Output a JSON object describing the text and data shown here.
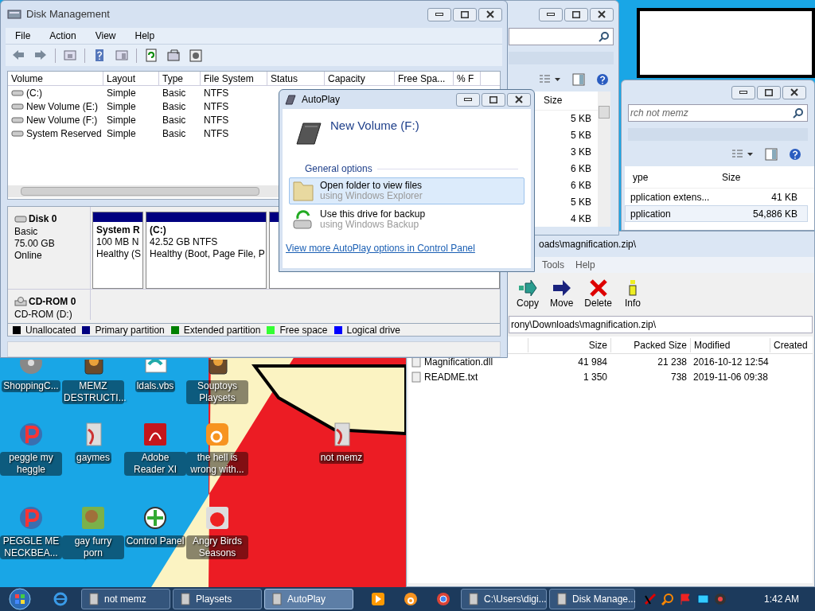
{
  "disk_management": {
    "title": "Disk Management",
    "menu": [
      "File",
      "Action",
      "View",
      "Help"
    ],
    "columns": [
      "Volume",
      "Layout",
      "Type",
      "File System",
      "Status",
      "Capacity",
      "Free Spa...",
      "% F"
    ],
    "rows": [
      {
        "cells": [
          "(C:)",
          "Simple",
          "Basic",
          "NTFS"
        ]
      },
      {
        "cells": [
          "New Volume (E:)",
          "Simple",
          "Basic",
          "NTFS"
        ]
      },
      {
        "cells": [
          "New Volume (F:)",
          "Simple",
          "Basic",
          "NTFS"
        ]
      },
      {
        "cells": [
          "System Reserved",
          "Simple",
          "Basic",
          "NTFS"
        ]
      }
    ],
    "disks": [
      {
        "kind": "disk",
        "name": "Disk 0",
        "lines": [
          "Basic",
          "75.00 GB",
          "Online"
        ],
        "partitions": [
          {
            "lines": [
              "System R",
              "100 MB N",
              "Healthy (S"
            ]
          },
          {
            "lines": [
              "(C:)",
              "42.52 GB NTFS",
              "Healthy (Boot, Page File, P"
            ]
          }
        ]
      },
      {
        "kind": "cdrom",
        "name": "CD-ROM 0",
        "lines": [
          "CD-ROM (D:)"
        ]
      }
    ],
    "legend": [
      {
        "label": "Unallocated",
        "color": "#000000"
      },
      {
        "label": "Primary partition",
        "color": "#000080"
      },
      {
        "label": "Extended partition",
        "color": "#008000"
      },
      {
        "label": "Free space",
        "color": "#33ff33"
      },
      {
        "label": "Logical drive",
        "color": "#0000ff"
      }
    ]
  },
  "explorer_back": {
    "column": "Size",
    "sizes": [
      "5 KB",
      "5 KB",
      "3 KB",
      "6 KB",
      "6 KB",
      "5 KB",
      "4 KB"
    ]
  },
  "explorer_front": {
    "search": {
      "placeholder": "rch not memz"
    },
    "columns": [
      "ype",
      "Size"
    ],
    "rows": [
      {
        "type": "pplication extens...",
        "size": "41 KB",
        "selected": false
      },
      {
        "type": "pplication",
        "size": "54,886 KB",
        "selected": true
      }
    ]
  },
  "autoplay": {
    "title": "AutoPlay",
    "drive": "New Volume (F:)",
    "section": "General options",
    "options": [
      {
        "kind": "folder",
        "title": "Open folder to view files",
        "subtitle": "using Windows Explorer",
        "selected": true
      },
      {
        "kind": "backup",
        "title": "Use this drive for backup",
        "subtitle": "using Windows Backup",
        "selected": false
      }
    ],
    "link": "View more AutoPlay options in Control Panel"
  },
  "sevenzip": {
    "title": "oads\\magnification.zip\\",
    "menu": [
      "Tools",
      "Help"
    ],
    "toolbar": [
      {
        "kind": "copy",
        "label": "Copy"
      },
      {
        "kind": "move",
        "label": "Move"
      },
      {
        "kind": "delete",
        "label": "Delete"
      },
      {
        "kind": "info",
        "label": "Info"
      }
    ],
    "path": "rony\\Downloads\\magnification.zip\\",
    "columns": [
      "Size",
      "Packed Size",
      "Modified",
      "Created"
    ],
    "rows": [
      {
        "name": "Magnification.dll",
        "size": "41 984",
        "packed": "21 238",
        "modified": "2016-10-12 12:54"
      },
      {
        "name": "README.txt",
        "size": "1 350",
        "packed": "738",
        "modified": "2019-11-06 09:38"
      }
    ]
  },
  "desktop_icons": [
    [
      {
        "kind": "disc",
        "label": "ShoppingC..."
      },
      {
        "kind": "program",
        "label": "MEMZ DESTRUCTI..."
      },
      {
        "kind": "script",
        "label": "ldals.vbs"
      },
      {
        "kind": "program",
        "label": "Souptoys Playsets"
      }
    ],
    [
      {
        "kind": "game",
        "label": "peggle my heggle"
      },
      {
        "kind": "folder",
        "label": "gaymes"
      },
      {
        "kind": "pdf",
        "label": "Adobe Reader XI"
      },
      {
        "kind": "browser",
        "label": "the hell is wrong with..."
      },
      {
        "kind": "folder",
        "label": "not memz"
      }
    ],
    [
      {
        "kind": "game",
        "label": "PEGGLE ME NECKBEA..."
      },
      {
        "kind": "box",
        "label": "gay furry porn"
      },
      {
        "kind": "control",
        "label": "Control Panel"
      },
      {
        "kind": "birds",
        "label": "Angry Birds Seasons"
      }
    ]
  ],
  "taskbar": {
    "windows": [
      {
        "label": "not memz",
        "selected": false
      },
      {
        "label": "Playsets",
        "selected": false
      },
      {
        "label": "AutoPlay",
        "selected": true
      }
    ],
    "windows_right": [
      {
        "label": "C:\\Users\\digi...",
        "selected": false
      },
      {
        "label": "Disk Manage...",
        "selected": false
      }
    ],
    "clock": "1:42 AM"
  }
}
